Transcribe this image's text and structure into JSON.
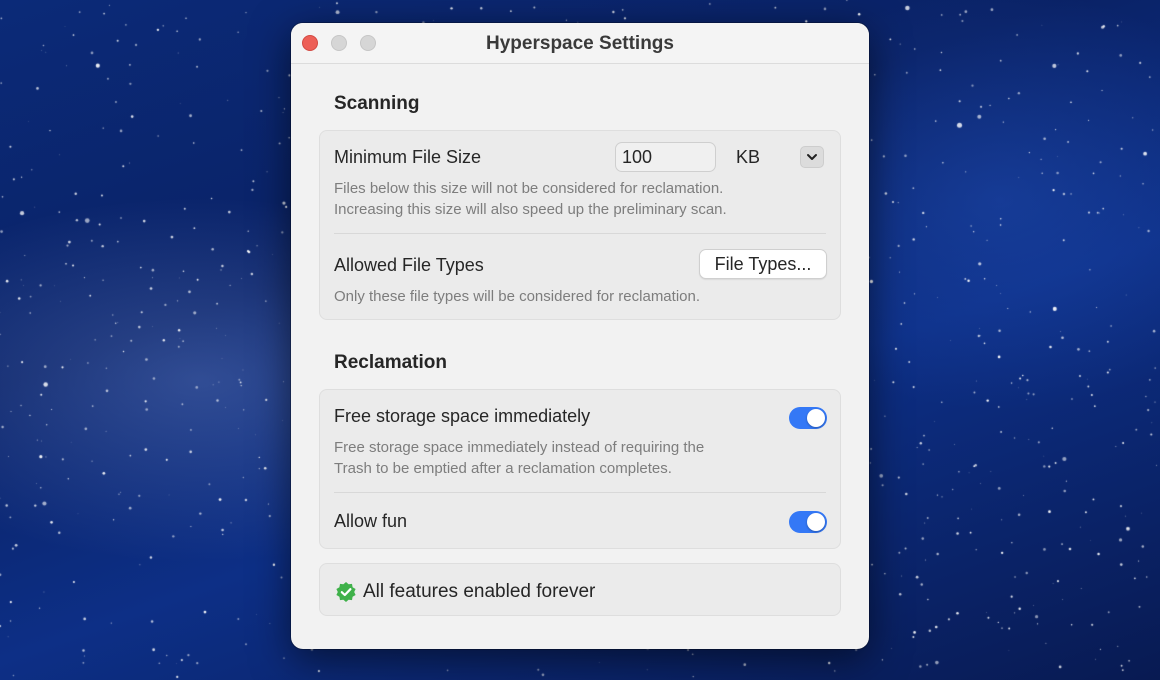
{
  "window": {
    "title": "Hyperspace Settings"
  },
  "scanning": {
    "title": "Scanning",
    "min_size": {
      "label": "Minimum File Size",
      "value": "100",
      "unit": "KB",
      "description_line1": "Files below this size will not be considered for reclamation.",
      "description_line2": "Increasing this size will also speed up the preliminary scan."
    },
    "file_types": {
      "label": "Allowed File Types",
      "button_label": "File Types...",
      "description": "Only these file types will be considered for reclamation."
    }
  },
  "reclamation": {
    "title": "Reclamation",
    "free_storage": {
      "label": "Free storage space immediately",
      "enabled": true,
      "description_line1": "Free storage space immediately instead of requiring the",
      "description_line2": "Trash to be emptied after a reclamation completes."
    },
    "allow_fun": {
      "label": "Allow fun",
      "enabled": true
    }
  },
  "status": {
    "text": "All features enabled forever"
  },
  "colors": {
    "accent": "#3478f6",
    "badge": "#3fb14a",
    "close": "#ed5f57"
  }
}
